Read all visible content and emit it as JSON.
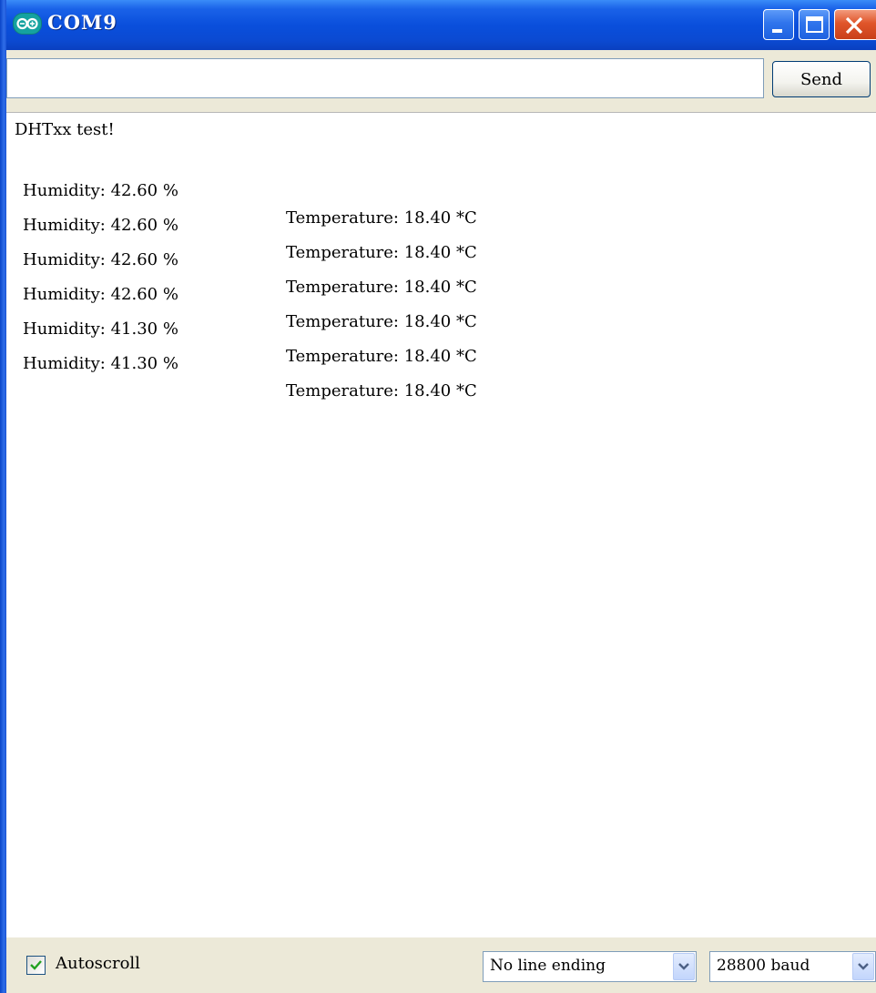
{
  "window": {
    "title": "COM9",
    "icon": "arduino-infinity-icon",
    "controls": [
      "minimize-icon",
      "maximize-icon",
      "close-icon"
    ]
  },
  "toolbar": {
    "input_value": "",
    "send_label": "Send"
  },
  "output": {
    "header_line": "DHTxx test!",
    "rows": [
      {
        "humidity": "Humidity: 42.60 %",
        "temperature": "Temperature: 18.40 *C"
      },
      {
        "humidity": "Humidity: 42.60 %",
        "temperature": "Temperature: 18.40 *C"
      },
      {
        "humidity": "Humidity: 42.60 %",
        "temperature": "Temperature: 18.40 *C"
      },
      {
        "humidity": "Humidity: 42.60 %",
        "temperature": "Temperature: 18.40 *C"
      },
      {
        "humidity": "Humidity: 41.30 %",
        "temperature": "Temperature: 18.40 *C"
      },
      {
        "humidity": "Humidity: 41.30 %",
        "temperature": "Temperature: 18.40 *C"
      }
    ]
  },
  "footer": {
    "autoscroll_label": "Autoscroll",
    "autoscroll_checked": true,
    "line_ending": "No line ending",
    "baud_rate": "28800 baud"
  },
  "colors": {
    "titlebar": "#0a4fdc",
    "close_button": "#e0552a",
    "panel": "#ece9d8"
  }
}
